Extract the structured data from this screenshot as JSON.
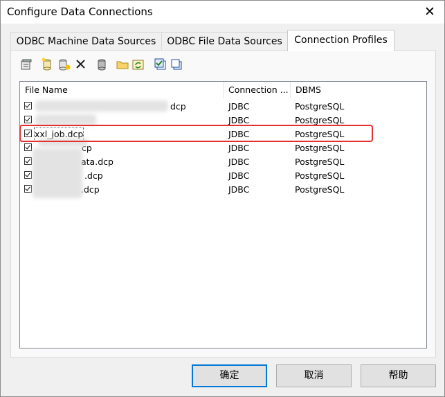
{
  "window": {
    "title": "Configure Data Connections"
  },
  "tabs": [
    {
      "label": "ODBC Machine Data Sources"
    },
    {
      "label": "ODBC File Data Sources"
    },
    {
      "label": "Connection Profiles"
    }
  ],
  "toolbar": {
    "icons": [
      "properties-icon",
      "new-database-icon",
      "add-database-icon",
      "delete-icon",
      "database-icon",
      "folder-icon",
      "refresh-icon",
      "check-all-icon",
      "copy-icon"
    ]
  },
  "list": {
    "columns": [
      "File Name",
      "Connection ...",
      "DBMS"
    ],
    "rows": [
      {
        "name": "dcp",
        "connection": "JDBC",
        "dbms": "PostgreSQL"
      },
      {
        "name": "",
        "connection": "JDBC",
        "dbms": "PostgreSQL"
      },
      {
        "name": "xxl_job.dcp",
        "connection": "JDBC",
        "dbms": "PostgreSQL"
      },
      {
        "name": "cp",
        "connection": "JDBC",
        "dbms": "PostgreSQL"
      },
      {
        "name": "ata.dcp",
        "connection": "JDBC",
        "dbms": "PostgreSQL"
      },
      {
        "name": ".dcp",
        "connection": "JDBC",
        "dbms": "PostgreSQL"
      },
      {
        "name": ".dcp",
        "connection": "JDBC",
        "dbms": "PostgreSQL"
      }
    ]
  },
  "buttons": {
    "ok": "确定",
    "cancel": "取消",
    "help": "帮助"
  },
  "colors": {
    "highlight": "#e33131",
    "default_button_border": "#0078d7"
  }
}
